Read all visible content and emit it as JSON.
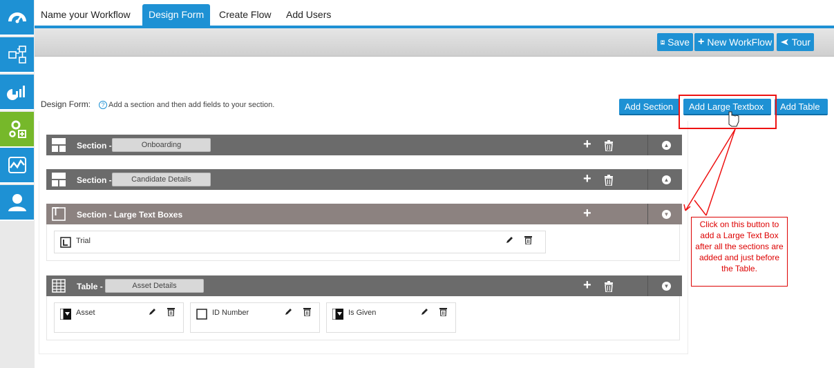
{
  "tabs": {
    "name_workflow": "Name your Workflow",
    "design_form": "Design Form",
    "create_flow": "Create Flow",
    "add_users": "Add Users"
  },
  "toolbar": {
    "save": "Save",
    "new_workflow": "New WorkFlow",
    "tour": "Tour"
  },
  "design": {
    "label": "Design Form:",
    "hint": "Add a section and then add fields to your section."
  },
  "actions": {
    "add_section": "Add Section",
    "add_large_textbox": "Add Large Textbox",
    "add_table": "Add Table"
  },
  "sections": [
    {
      "title": "Section -",
      "name": "Onboarding"
    },
    {
      "title": "Section -",
      "name": "Candidate Details"
    },
    {
      "title": "Section - Large Text Boxes",
      "fields": [
        "Trial"
      ]
    },
    {
      "title": "Table -",
      "name": "Asset Details",
      "fields": [
        "Asset",
        "ID Number",
        "Is Given"
      ]
    }
  ],
  "callout": "Click on this button to add a Large Text Box after all the sections are added and just before the Table.",
  "colors": {
    "accent": "#1e91d4",
    "active_nav": "#76b82a",
    "section_bar": "#6b6b6b",
    "annotation": "#ee1111"
  },
  "icons": {
    "sidebar": [
      "dashboard-icon",
      "workflow-icon",
      "reports-icon",
      "settings-icon",
      "activity-icon",
      "user-icon"
    ],
    "toolbar": [
      "save-icon",
      "plus-icon",
      "plane-icon"
    ]
  }
}
